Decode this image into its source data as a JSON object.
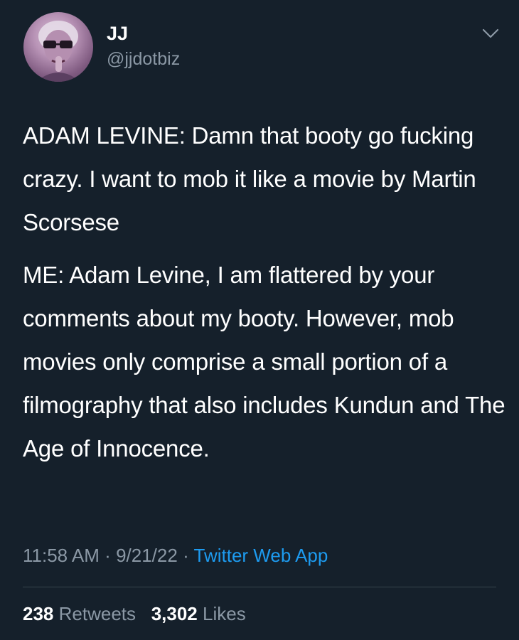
{
  "user": {
    "display_name": "JJ",
    "handle": "@jjdotbiz"
  },
  "tweet": {
    "paragraph_1": "ADAM LEVINE: Damn that booty go fucking crazy. I want to mob it like a movie by Martin Scorsese",
    "paragraph_2": "ME: Adam Levine, I am flattered by your comments about my booty. However, mob movies only comprise a small portion of a filmography that also includes Kundun and The Age of Innocence."
  },
  "meta": {
    "time": "11:58 AM",
    "date": "9/21/22",
    "source": "Twitter Web App",
    "separator": "·"
  },
  "stats": {
    "retweets_count": "238",
    "retweets_label": "Retweets",
    "likes_count": "3,302",
    "likes_label": "Likes"
  },
  "colors": {
    "background": "#15202b",
    "text_primary": "#ffffff",
    "text_secondary": "#8b98a5",
    "link": "#1d9bf0",
    "divider": "#38444d"
  },
  "icons": {
    "menu": "chevron-down-icon"
  }
}
